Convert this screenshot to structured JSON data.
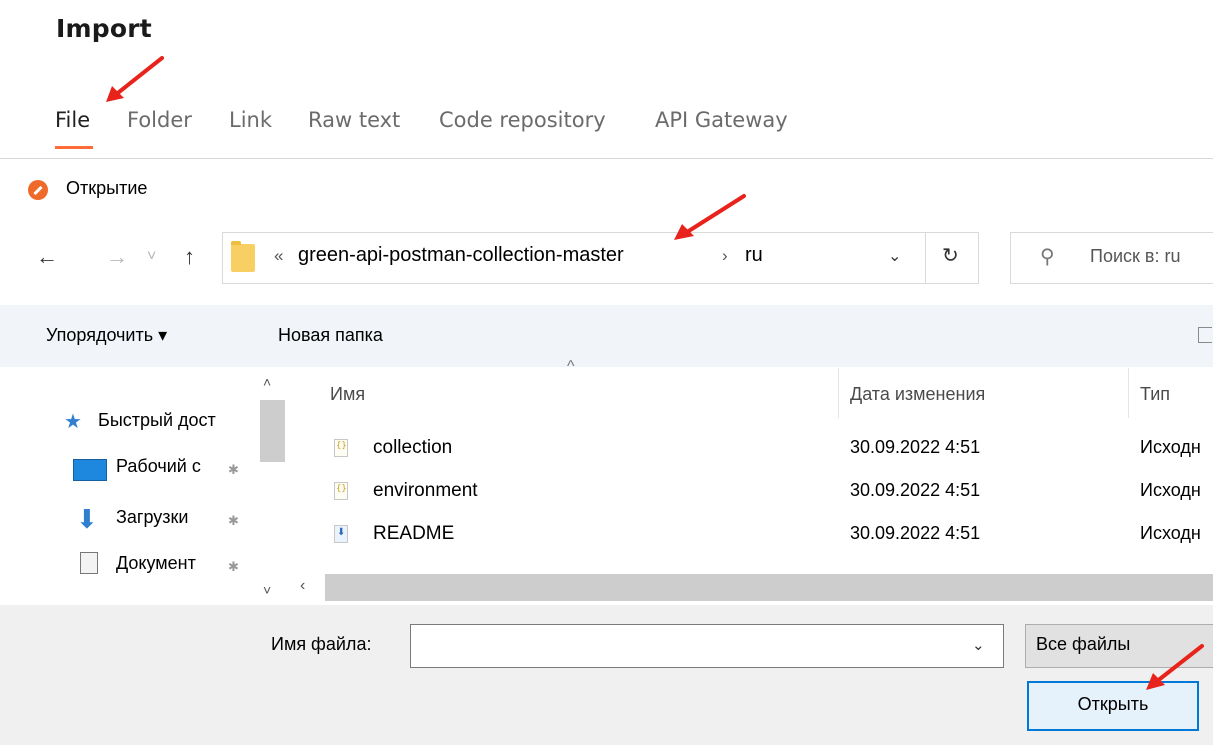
{
  "postman": {
    "title": "Import",
    "tabs": [
      {
        "label": "File",
        "active": true
      },
      {
        "label": "Folder"
      },
      {
        "label": "Link"
      },
      {
        "label": "Raw text"
      },
      {
        "label": "Code repository"
      },
      {
        "label": "API Gateway"
      }
    ],
    "accent": "#ff6c37"
  },
  "dialog": {
    "title": "Открытие",
    "nav": {
      "back": "←",
      "forward": "→",
      "recent": "˅",
      "up": "↑"
    },
    "address": {
      "overflow": "«",
      "folder": "green-api-postman-collection-master",
      "separator": "›",
      "current": "ru",
      "dropdown": "⌄",
      "refresh": "↻"
    },
    "search": {
      "placeholder": "Поиск в: ru"
    },
    "commands": {
      "organize": "Упорядочить ▾",
      "new_folder": "Новая папка"
    },
    "nav_pane": [
      {
        "label": "Быстрый дост",
        "icon": "star-icon"
      },
      {
        "label": "Рабочий с",
        "icon": "desktop-icon",
        "pinned": true
      },
      {
        "label": "Загрузки",
        "icon": "download-icon",
        "pinned": true
      },
      {
        "label": "Документ",
        "icon": "document-icon",
        "pinned": true
      }
    ],
    "columns": {
      "name": "Имя",
      "date": "Дата изменения",
      "type": "Тип"
    },
    "files": [
      {
        "name": "collection",
        "date": "30.09.2022 4:51",
        "type": "Исходн",
        "icon": "json-file-icon"
      },
      {
        "name": "environment",
        "date": "30.09.2022 4:51",
        "type": "Исходн",
        "icon": "json-file-icon"
      },
      {
        "name": "README",
        "date": "30.09.2022 4:51",
        "type": "Исходн",
        "icon": "markdown-file-icon"
      }
    ],
    "filename": {
      "label": "Имя файла:",
      "value": ""
    },
    "filter": "Все файлы",
    "open_button": "Открыть",
    "scroll": {
      "up": "˄",
      "down": "˅",
      "left": "‹",
      "sort": "^"
    },
    "pin": "📌"
  },
  "annotations": {
    "arrow_color": "#e8231b"
  }
}
